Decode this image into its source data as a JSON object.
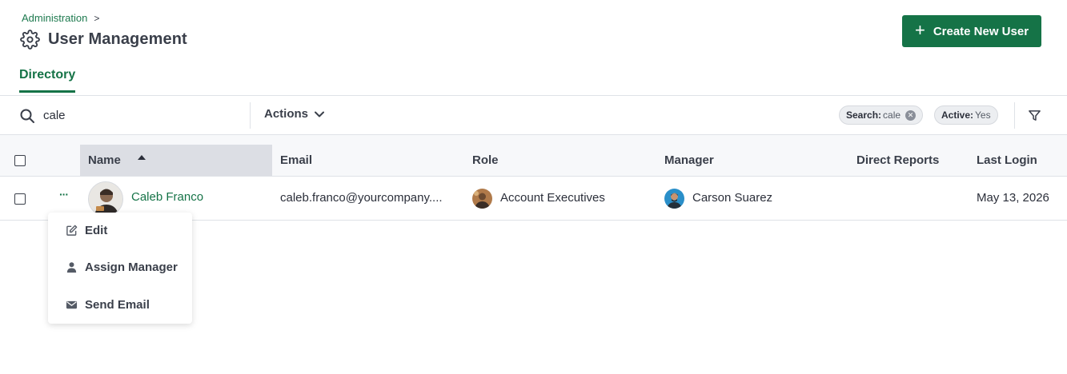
{
  "breadcrumb": {
    "parent": "Administration",
    "separator": ">"
  },
  "page": {
    "title": "User Management",
    "icon": "gear-icon"
  },
  "header": {
    "create_button": "Create New User",
    "create_icon": "+"
  },
  "tabs": [
    {
      "label": "Directory",
      "active": true
    }
  ],
  "toolbar": {
    "search_value": "cale",
    "actions_label": "Actions",
    "chips": [
      {
        "key": "Search:",
        "value": "cale",
        "removable": true
      },
      {
        "key": "Active:",
        "value": "Yes",
        "removable": false
      }
    ]
  },
  "table": {
    "columns": [
      "Name",
      "Email",
      "Role",
      "Manager",
      "Direct Reports",
      "Last Login"
    ],
    "sorted_column": "Name",
    "sort_direction": "ascending",
    "rows": [
      {
        "name": "Caleb Franco",
        "email": "caleb.franco@yourcompany....",
        "role": "Account Executives",
        "manager": "Carson Suarez",
        "direct_reports": "",
        "last_login": "May 13, 2026",
        "more_label": "···"
      }
    ]
  },
  "row_menu": {
    "items": [
      {
        "label": "Edit",
        "icon": "edit-icon"
      },
      {
        "label": "Assign Manager",
        "icon": "person-icon"
      },
      {
        "label": "Send Email",
        "icon": "envelope-icon"
      }
    ]
  },
  "colors": {
    "accent": "#157347",
    "header_bg": "#f7f8fa",
    "sorted_header_bg": "#dcdee4"
  }
}
